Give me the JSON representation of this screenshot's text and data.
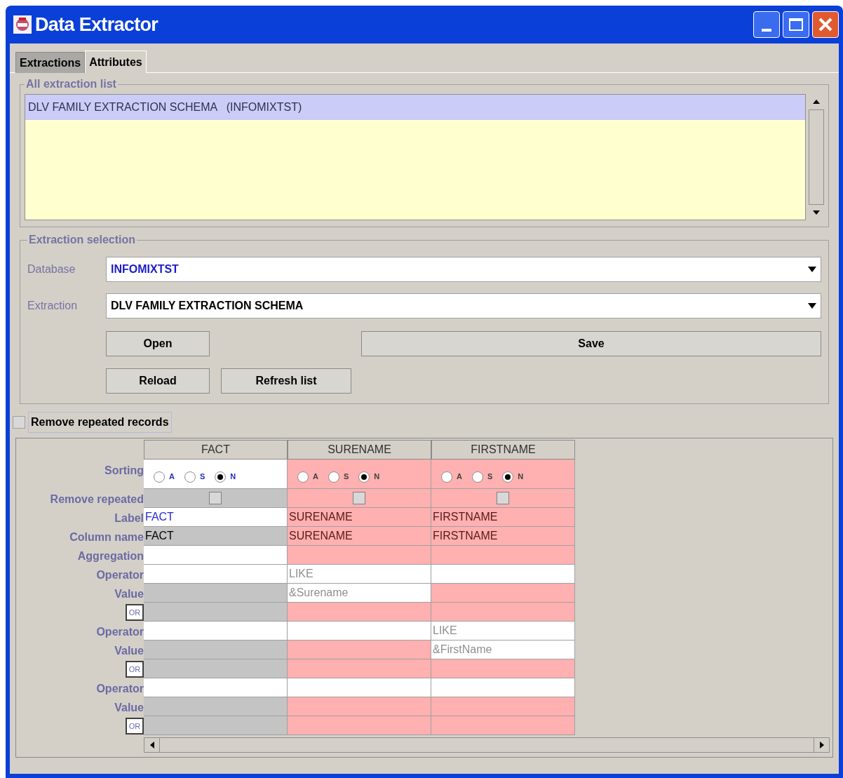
{
  "window": {
    "title": "Data Extractor"
  },
  "tabs": [
    {
      "label": "Extractions",
      "selected": false
    },
    {
      "label": "Attributes",
      "selected": true
    }
  ],
  "extraction_list": {
    "title": "All extraction list",
    "items": [
      {
        "text": "DLV FAMILY EXTRACTION SCHEMA   (INFOMIXTST)",
        "selected": true
      }
    ]
  },
  "extraction_selection": {
    "title": "Extraction selection",
    "fields": [
      {
        "label": "Database",
        "value": "INFOMIXTST",
        "kind": "highlight"
      },
      {
        "label": "Extraction",
        "value": "DLV FAMILY EXTRACTION SCHEMA",
        "kind": "plain"
      }
    ],
    "buttons_row_1": [
      {
        "label": "Open",
        "kind": "short"
      },
      {
        "label": "Save",
        "kind": "wide"
      }
    ],
    "buttons_row_2": [
      {
        "label": "Reload",
        "kind": "short"
      },
      {
        "label": "Refresh list",
        "kind": "medium"
      }
    ]
  },
  "remove_repeated_records": {
    "label": "Remove repeated records",
    "checked": false
  },
  "table": {
    "columns": [
      {
        "header": "FACT",
        "highlighted": false
      },
      {
        "header": "SURENAME",
        "highlighted": true
      },
      {
        "header": "FIRSTNAME",
        "highlighted": true
      }
    ],
    "rows": [
      {
        "kind": "sorting",
        "label": "Sorting",
        "cells": [
          {
            "editable": true,
            "options": [
              {
                "label": "A",
                "selected": false
              },
              {
                "label": "S",
                "selected": false
              },
              {
                "label": "N",
                "selected": true
              }
            ]
          },
          {
            "editable": false,
            "options": [
              {
                "label": "A",
                "selected": false
              },
              {
                "label": "S",
                "selected": false
              },
              {
                "label": "N",
                "selected": true
              }
            ]
          },
          {
            "editable": false,
            "options": [
              {
                "label": "A",
                "selected": false
              },
              {
                "label": "S",
                "selected": false
              },
              {
                "label": "N",
                "selected": true
              }
            ]
          }
        ]
      },
      {
        "kind": "checkbox",
        "label": "Remove repeated",
        "cells": [
          {
            "editable": false,
            "checked": false
          },
          {
            "editable": false,
            "checked": false
          },
          {
            "editable": false,
            "checked": false
          }
        ]
      },
      {
        "kind": "label",
        "label": "Label",
        "cells": [
          {
            "editable": true,
            "text": "FACT"
          },
          {
            "editable": false,
            "text": "SURENAME"
          },
          {
            "editable": false,
            "text": "FIRSTNAME"
          }
        ]
      },
      {
        "kind": "name",
        "label": "Column name",
        "cells": [
          {
            "editable": false,
            "text": "FACT"
          },
          {
            "editable": false,
            "text": "SURENAME"
          },
          {
            "editable": false,
            "text": "FIRSTNAME"
          }
        ]
      },
      {
        "kind": "condition",
        "label": "Aggregation",
        "cells": [
          {
            "editable": true
          },
          {
            "editable": false
          },
          {
            "editable": false
          }
        ]
      },
      {
        "kind": "condition",
        "label": "Operator",
        "cells": [
          {
            "editable": true
          },
          {
            "editable": true,
            "text": "LIKE"
          },
          {
            "editable": true
          }
        ]
      },
      {
        "kind": "condition",
        "label": "Value",
        "cells": [
          {
            "editable": false
          },
          {
            "editable": true,
            "text": "&Surename"
          },
          {
            "editable": false
          }
        ]
      },
      {
        "kind": "or",
        "button": "OR",
        "cells": [
          {
            "editable": false
          },
          {
            "editable": false
          },
          {
            "editable": false
          }
        ]
      },
      {
        "kind": "condition",
        "label": "Operator",
        "cells": [
          {
            "editable": true
          },
          {
            "editable": true
          },
          {
            "editable": true,
            "text": "LIKE"
          }
        ]
      },
      {
        "kind": "condition",
        "label": "Value",
        "cells": [
          {
            "editable": false
          },
          {
            "editable": false
          },
          {
            "editable": true,
            "text": "&FirstName"
          }
        ]
      },
      {
        "kind": "or",
        "button": "OR",
        "cells": [
          {
            "editable": false
          },
          {
            "editable": false
          },
          {
            "editable": false
          }
        ]
      },
      {
        "kind": "condition",
        "label": "Operator",
        "cells": [
          {
            "editable": true
          },
          {
            "editable": true
          },
          {
            "editable": true
          }
        ]
      },
      {
        "kind": "condition",
        "label": "Value",
        "cells": [
          {
            "editable": false
          },
          {
            "editable": false
          },
          {
            "editable": false
          }
        ]
      },
      {
        "kind": "or",
        "button": "OR",
        "cells": [
          {
            "editable": false
          },
          {
            "editable": false
          },
          {
            "editable": false
          }
        ]
      }
    ]
  }
}
